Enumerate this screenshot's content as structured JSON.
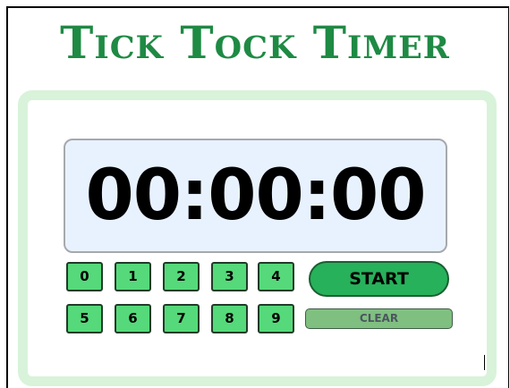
{
  "app": {
    "title": "Tick Tock Timer"
  },
  "display": {
    "time": "00:00:00"
  },
  "keypad": {
    "keys": [
      "0",
      "1",
      "2",
      "3",
      "4",
      "5",
      "6",
      "7",
      "8",
      "9"
    ]
  },
  "controls": {
    "start_label": "START",
    "clear_label": "CLEAR"
  },
  "colors": {
    "title_green": "#1e8a44",
    "panel_border": "#d8f3da",
    "display_bg": "#e8f2ff",
    "key_green": "#55d97a",
    "start_green": "#27b15a",
    "clear_green": "#7fbf80"
  }
}
